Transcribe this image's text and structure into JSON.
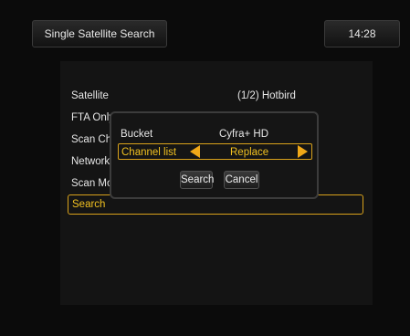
{
  "header": {
    "title": "Single Satellite Search",
    "clock": "14:28"
  },
  "menu": {
    "items": [
      {
        "label": "Satellite",
        "value": "(1/2) Hotbird"
      },
      {
        "label": "FTA Only",
        "value": ""
      },
      {
        "label": "Scan Cha",
        "value": ""
      },
      {
        "label": "Network S",
        "value": ""
      },
      {
        "label": "Scan Mo",
        "value": ""
      },
      {
        "label": "Search",
        "value": ""
      }
    ]
  },
  "dialog": {
    "bucket_label": "Bucket",
    "bucket_value": "Cyfra+ HD",
    "channel_list_label": "Channel list",
    "channel_list_value": "Replace",
    "search_button": "Search",
    "cancel_button": "Cancel",
    "left_arrow_icon": "triangle-left-icon",
    "right_arrow_icon": "triangle-right-icon"
  },
  "colors": {
    "accent": "#f0c020",
    "arrow": "#f0a818",
    "background": "#0b0b0b"
  }
}
